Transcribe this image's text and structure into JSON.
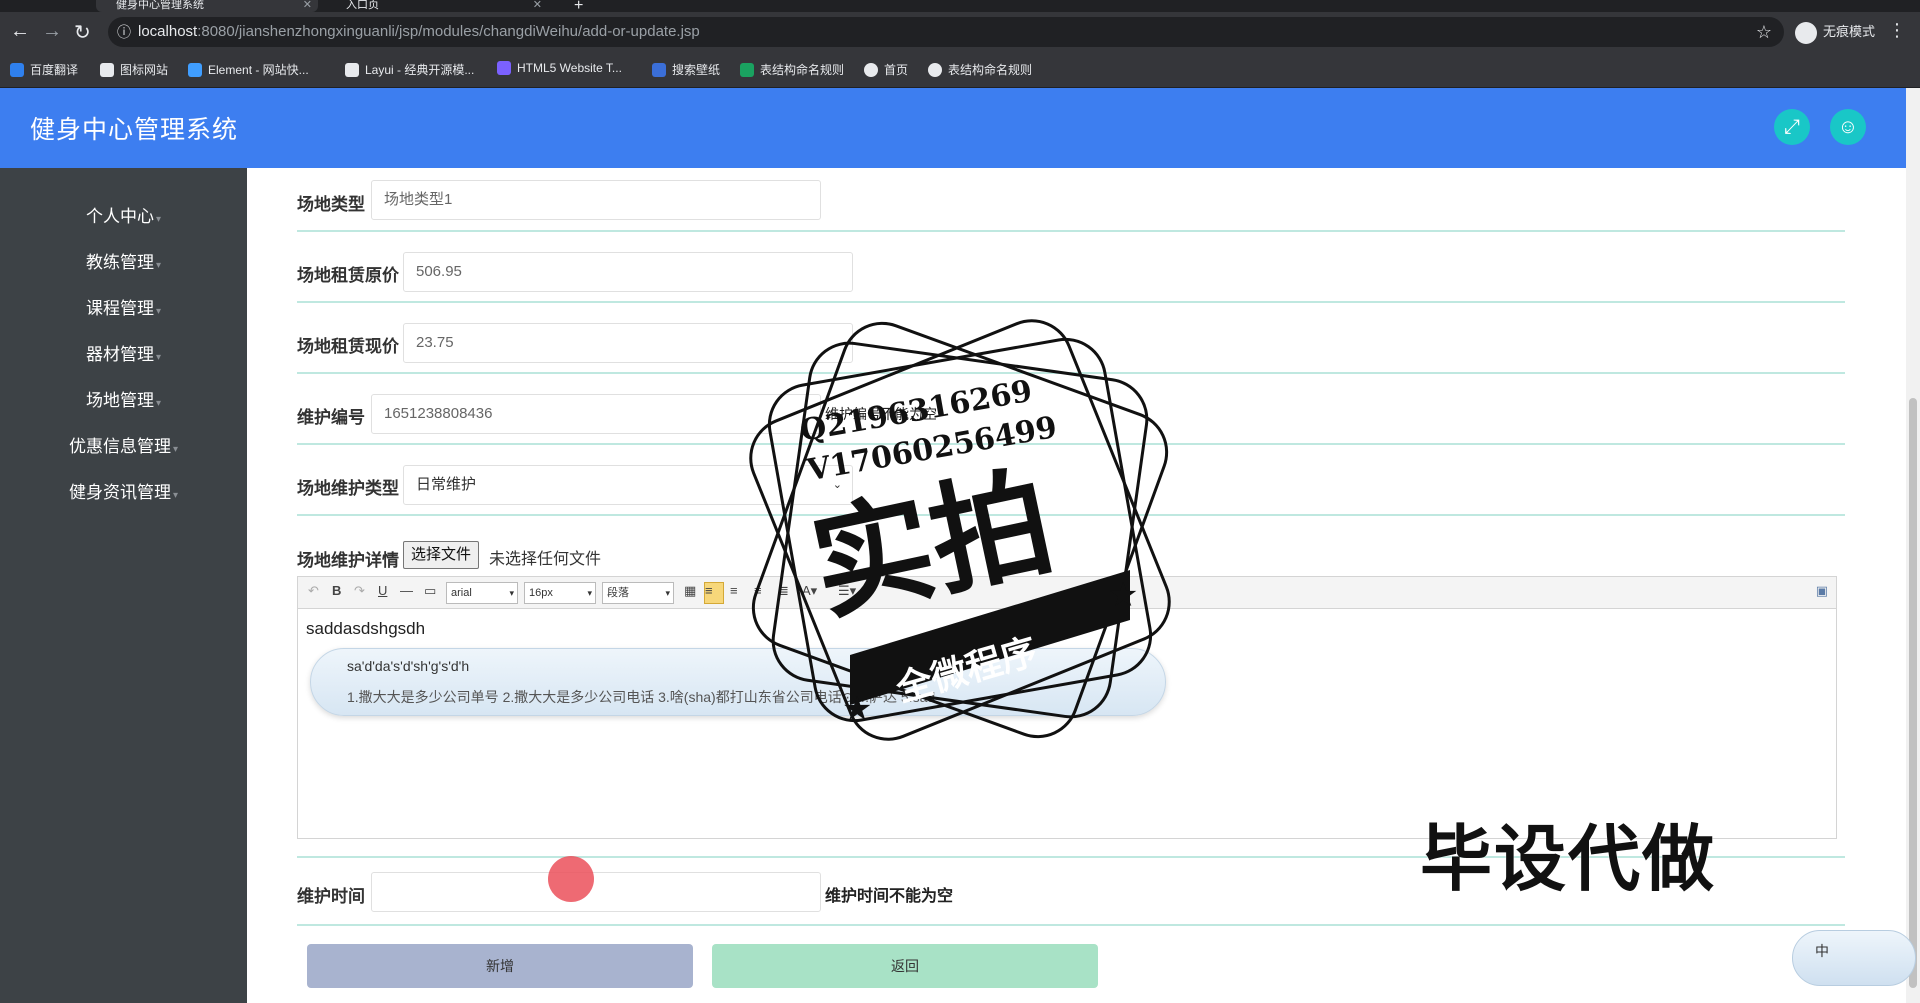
{
  "browser": {
    "tabs": [
      {
        "title": "健身中心管理系统"
      },
      {
        "title": "入口页"
      }
    ],
    "url_host": "localhost",
    "url_path": ":8080/jianshenzhongxinguanli/jsp/modules/changdiWeihu/add-or-update.jsp",
    "profile_label": "无痕模式",
    "bookmarks": [
      {
        "label": "百度翻译",
        "color": "#2f80ed"
      },
      {
        "label": "图标网站",
        "color": "#e8eaed"
      },
      {
        "label": "Element - 网站快...",
        "color": "#409eff"
      },
      {
        "label": "Layui - 经典开源模...",
        "color": "#e8eaed"
      },
      {
        "label": "HTML5 Website T...",
        "color": "#7b61ff"
      },
      {
        "label": "搜索壁纸",
        "color": "#3b6fd8"
      },
      {
        "label": "表结构命名规则",
        "color": "#1aa260"
      },
      {
        "label": "首页",
        "color": "#e8eaed"
      },
      {
        "label": "表结构命名规则",
        "color": "#e8eaed"
      }
    ]
  },
  "app": {
    "title": "健身中心管理系统",
    "header_icons": [
      "fullscreen-icon",
      "user-icon"
    ],
    "colors": {
      "header": "#3d7ef0",
      "sidebar": "#3d4246",
      "accent": "#19c7c7"
    }
  },
  "sidebar": {
    "items": [
      {
        "label": "个人中心"
      },
      {
        "label": "教练管理"
      },
      {
        "label": "课程管理"
      },
      {
        "label": "器材管理"
      },
      {
        "label": "场地管理"
      },
      {
        "label": "优惠信息管理"
      },
      {
        "label": "健身资讯管理"
      }
    ]
  },
  "form": {
    "venue_type": {
      "label": "场地类型",
      "value": "场地类型1"
    },
    "original_price": {
      "label": "场地租赁原价",
      "value": "506.95"
    },
    "current_price": {
      "label": "场地租赁现价",
      "value": "23.75"
    },
    "maintenance_no": {
      "label": "维护编号",
      "value": "1651238808436",
      "error": "维护编号不能为空"
    },
    "maintenance_type": {
      "label": "场地维护类型",
      "value": "日常维护"
    },
    "maintenance_detail": {
      "label": "场地维护详情",
      "file_button": "选择文件",
      "file_status": "未选择任何文件",
      "editor_font": "arial",
      "editor_size": "16px",
      "editor_paragraph": "段落",
      "content": "saddasdshgsdh"
    },
    "maintenance_time": {
      "label": "维护时间",
      "value": "",
      "error": "维护时间不能为空"
    },
    "submit_label": "新增",
    "back_label": "返回"
  },
  "ime": {
    "pinyin": "sa'd'da's'd'sh'g's'd'h",
    "candidates": "1.撒大大是多少公司单号   2.撒大大是多少公司电话   3.啥(sha)都打山东省公司电话⊙   4.萨达   5.sad",
    "float_label": "中"
  },
  "watermark": {
    "qq": "Q2196316269",
    "v": "V17060256499",
    "big": "实拍",
    "banner": "全微程序",
    "corner": "毕设代做"
  }
}
